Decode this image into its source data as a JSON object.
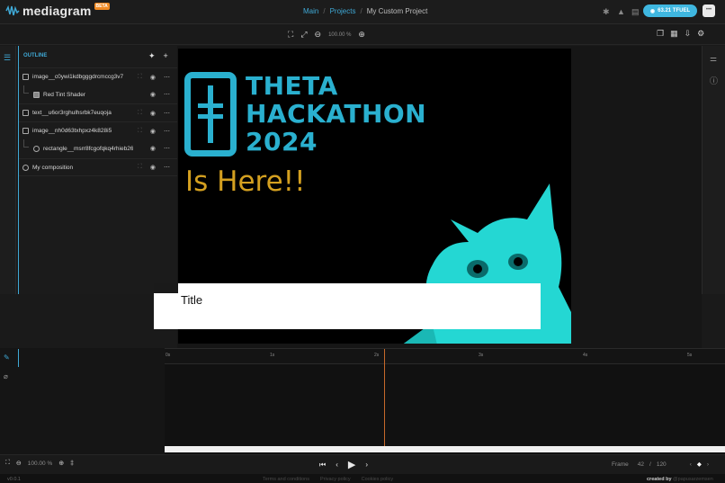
{
  "app": {
    "name": "mediagram",
    "badge": "BETA"
  },
  "breadcrumb": {
    "main": "Main",
    "projects": "Projects",
    "sep": "/",
    "current": "My Custom Project"
  },
  "fuel": {
    "label": "63.21 TFUEL"
  },
  "zoom": {
    "value": "100.00 %"
  },
  "outline": {
    "title": "OUTLINE",
    "items": [
      {
        "label": "image__c0ywi1kdbgggdrcmccg3v7",
        "icon": "image-icon"
      },
      {
        "label": "Red Tint Shader",
        "icon": "shader-icon"
      },
      {
        "label": "text__u6or3rghulhsrbk7euqoja",
        "icon": "text-icon"
      },
      {
        "label": "image__nh0d63txhpxz4k828i5",
        "icon": "image-icon"
      },
      {
        "label": "rectangle__msrr8fcgofqkq4rhieb26l",
        "icon": "rectangle-icon"
      },
      {
        "label": "My composition",
        "icon": "composition-icon"
      }
    ]
  },
  "canvas": {
    "headline": [
      "THETA",
      "HACKATHON",
      "2024"
    ],
    "subhead": "Is Here!!",
    "title_box": "Title",
    "colors": {
      "theta": "#2ab0cf",
      "gold": "#d4a020",
      "cat": "#24d7d3"
    }
  },
  "timeline": {
    "ticks": [
      "0s",
      "1s",
      "2s",
      "3s",
      "4s",
      "5s"
    ]
  },
  "playback": {
    "frame_label": "Frame",
    "frame": "42",
    "sep": "/",
    "total": "120",
    "zoom": "100.00 %"
  },
  "footer": {
    "version": "v0.0.1",
    "links": [
      "Terms and conditions",
      "Privacy policy",
      "Cookies policy"
    ],
    "created_by": "created by",
    "author": "@papusarzemsen"
  }
}
